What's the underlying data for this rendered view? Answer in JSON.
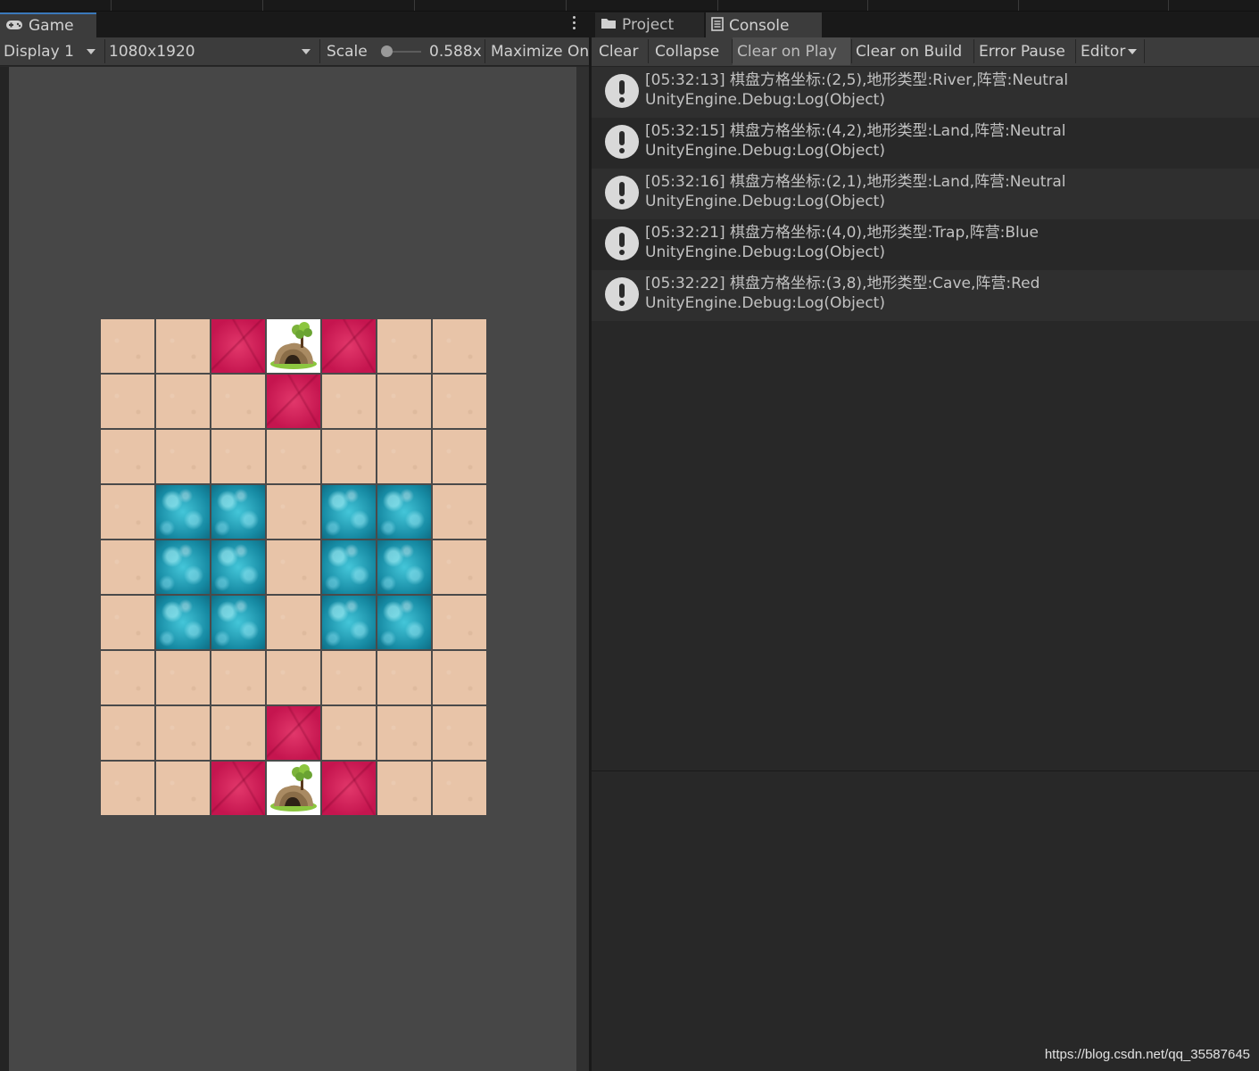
{
  "game_panel": {
    "tab_label": "Game",
    "toolbar": {
      "display": "Display 1",
      "resolution": "1080x1920",
      "scale_label": "Scale",
      "scale_value": "0.588x",
      "maximize": "Maximize On"
    },
    "board": {
      "rows": 9,
      "cols": 7,
      "layout": [
        [
          "land",
          "land",
          "trap",
          "cave",
          "trap",
          "land",
          "land"
        ],
        [
          "land",
          "land",
          "land",
          "trap",
          "land",
          "land",
          "land"
        ],
        [
          "land",
          "land",
          "land",
          "land",
          "land",
          "land",
          "land"
        ],
        [
          "land",
          "river",
          "river",
          "land",
          "river",
          "river",
          "land"
        ],
        [
          "land",
          "river",
          "river",
          "land",
          "river",
          "river",
          "land"
        ],
        [
          "land",
          "river",
          "river",
          "land",
          "river",
          "river",
          "land"
        ],
        [
          "land",
          "land",
          "land",
          "land",
          "land",
          "land",
          "land"
        ],
        [
          "land",
          "land",
          "land",
          "trap",
          "land",
          "land",
          "land"
        ],
        [
          "land",
          "land",
          "trap",
          "cave",
          "trap",
          "land",
          "land"
        ]
      ]
    }
  },
  "console_panel": {
    "tabs": {
      "project": "Project",
      "console": "Console"
    },
    "toolbar": {
      "clear": "Clear",
      "collapse": "Collapse",
      "clear_on_play": "Clear on Play",
      "clear_on_build": "Clear on Build",
      "error_pause": "Error Pause",
      "editor": "Editor"
    },
    "logs": [
      {
        "line1": "[05:32:13] 棋盘方格坐标:(2,5),地形类型:River,阵营:Neutral",
        "line2": "UnityEngine.Debug:Log(Object)"
      },
      {
        "line1": "[05:32:15] 棋盘方格坐标:(4,2),地形类型:Land,阵营:Neutral",
        "line2": "UnityEngine.Debug:Log(Object)"
      },
      {
        "line1": "[05:32:16] 棋盘方格坐标:(2,1),地形类型:Land,阵营:Neutral",
        "line2": "UnityEngine.Debug:Log(Object)"
      },
      {
        "line1": "[05:32:21] 棋盘方格坐标:(4,0),地形类型:Trap,阵营:Blue",
        "line2": "UnityEngine.Debug:Log(Object)"
      },
      {
        "line1": "[05:32:22] 棋盘方格坐标:(3,8),地形类型:Cave,阵营:Red",
        "line2": "UnityEngine.Debug:Log(Object)"
      }
    ]
  },
  "watermark": "https://blog.csdn.net/qq_35587645",
  "colors": {
    "land": "#e8c4a8",
    "trap": "#d52a5e",
    "river": "#2aa9c0",
    "cave_bg": "#ffffff",
    "tab_accent": "#3a79bb"
  },
  "icons": {
    "game_tab": "gamepad-icon",
    "project_tab": "folder-icon",
    "console_tab": "console-icon",
    "log_entry": "info-exclamation-icon",
    "menu": "kebab-menu-icon"
  }
}
